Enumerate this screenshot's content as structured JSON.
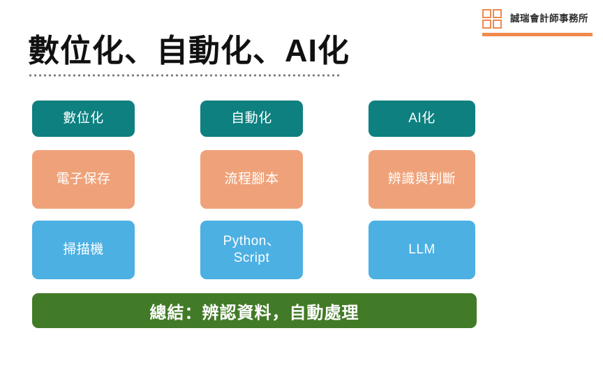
{
  "slide": {
    "title": "數位化、自動化、AI化",
    "accent_orange": "#F08A4B",
    "colors": {
      "header_box": "#0E8080",
      "middle_box": "#EFA279",
      "bottom_box": "#4CB0E3",
      "summary_bar": "#427B27",
      "title_text": "#111111"
    }
  },
  "brand": {
    "name": "誠瑞會計師事務所",
    "logo_icon": "four-squares-grid-icon"
  },
  "matrix": {
    "header_row": [
      {
        "label": "數位化"
      },
      {
        "label": "自動化"
      },
      {
        "label": "AI化"
      }
    ],
    "middle_row": [
      {
        "label": "電子保存"
      },
      {
        "label": "流程腳本"
      },
      {
        "label": "辨識與判斷"
      }
    ],
    "bottom_row": [
      {
        "label": "掃描機"
      },
      {
        "label": "Python、\nScript"
      },
      {
        "label": "LLM"
      }
    ]
  },
  "summary": {
    "label": "總結：辨認資料，自動處理"
  }
}
